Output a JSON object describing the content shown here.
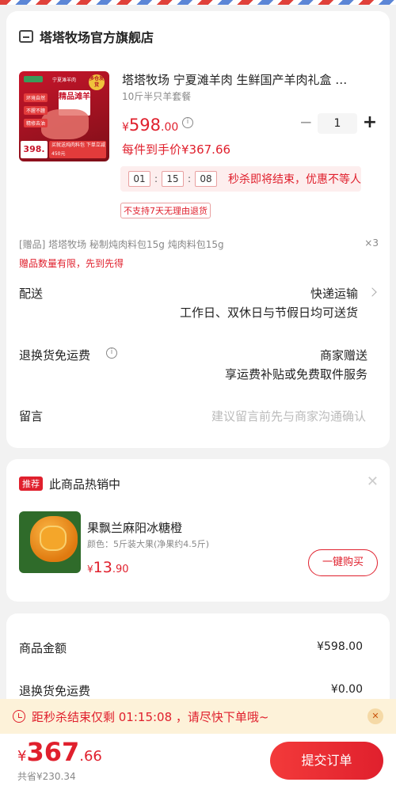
{
  "store": {
    "name": "塔塔牧场官方旗舰店",
    "icon": "store-icon"
  },
  "product": {
    "title": "塔塔牧场 宁夏滩羊肉 生鲜国产羊肉礼盒 …",
    "spec": "10斤半只羊套餐",
    "price_currency": "¥",
    "price_int": "598",
    "price_dec": ".00",
    "quantity": "1",
    "unit_price": "每件到手价¥367.66",
    "thumb": {
      "brand": "宁夏滩羊肉",
      "badge": "多仓发货",
      "label": "精品滩羊",
      "tags": [
        "环境自然",
        "不腥不膻",
        "精修去油"
      ],
      "price": "398.",
      "promo": "买就送炖肉料包 下单立减450元"
    }
  },
  "countdown": {
    "h": "01",
    "m": "15",
    "s": "08",
    "text": "秒杀即将结束，优惠不等人"
  },
  "no_return": "不支持7天无理由退货",
  "gift": {
    "text": "[赠品]  塔塔牧场 秘制炖肉料包15g 炖肉料包15g",
    "mult": "×3",
    "note": "赠品数量有限，先到先得"
  },
  "delivery": {
    "label": "配送",
    "value": "快递运输",
    "sub": "工作日、双休日与节假日均可送货"
  },
  "return_fee": {
    "label": "退换货免运费",
    "value": "商家赠送",
    "sub": "享运费补贴或免费取件服务"
  },
  "message": {
    "label": "留言",
    "placeholder": "建议留言前先与商家沟通确认"
  },
  "recommend": {
    "badge": "推荐",
    "title": "此商品热销中",
    "item": {
      "name": "果飘兰麻阳冰糖橙",
      "spec": "颜色：5斤装大果(净果约4.5斤)",
      "price_currency": "¥",
      "price_int": "13",
      "price_dec": ".90",
      "buy_label": "一键购买"
    }
  },
  "summary": {
    "rows": [
      {
        "label": "商品金额",
        "value": "¥598.00"
      },
      {
        "label": "退换货免运费",
        "value": "¥0.00"
      }
    ]
  },
  "banner": {
    "text": "距秒杀结束仅剩 01:15:08 ，请尽快下单哦~"
  },
  "footer": {
    "currency": "¥",
    "total_int": "367",
    "total_dec": ".66",
    "saved": "共省¥230.34",
    "submit_label": "提交订单"
  },
  "colors": {
    "accent": "#e0202d",
    "banner_bg": "#fdf2d9",
    "page_bg": "#f2f2f2"
  }
}
